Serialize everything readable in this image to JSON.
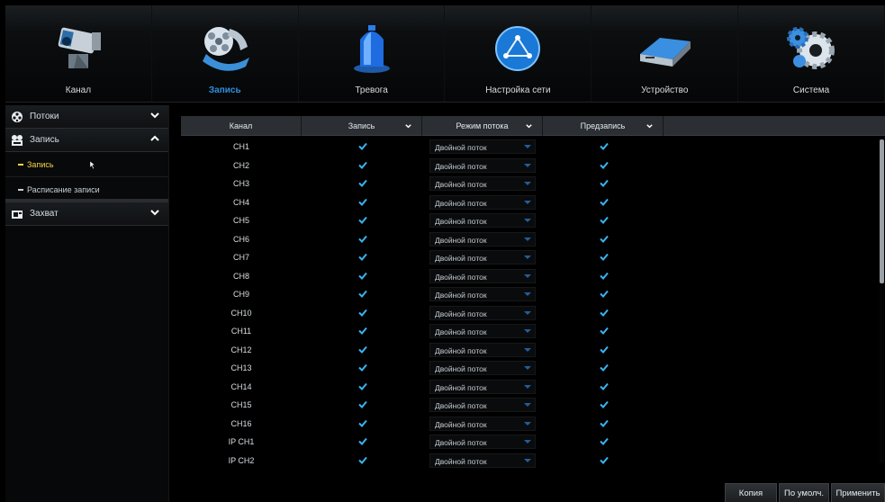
{
  "nav": {
    "tabs": [
      {
        "label": "Канал",
        "icon": "camera-icon",
        "active": false
      },
      {
        "label": "Запись",
        "icon": "film-reel-icon",
        "active": true
      },
      {
        "label": "Тревога",
        "icon": "alarm-siren-icon",
        "active": false
      },
      {
        "label": "Настройка сети",
        "icon": "network-globe-icon",
        "active": false
      },
      {
        "label": "Устройство",
        "icon": "hard-drive-icon",
        "active": false
      },
      {
        "label": "Система",
        "icon": "gears-icon",
        "active": false
      }
    ]
  },
  "sidebar": {
    "groups": [
      {
        "label": "Потоки",
        "icon": "stream-icon",
        "expanded": false
      },
      {
        "label": "Запись",
        "icon": "record-icon",
        "expanded": true,
        "items": [
          {
            "label": "Запись",
            "active": true
          },
          {
            "label": "Расписание записи",
            "active": false
          }
        ]
      },
      {
        "label": "Захват",
        "icon": "capture-icon",
        "expanded": false
      }
    ]
  },
  "table": {
    "columns": {
      "channel": "Канал",
      "record": "Запись",
      "stream_mode": "Режим потока",
      "prerecord": "Предзапись"
    },
    "rows": [
      {
        "channel": "CH1",
        "record": true,
        "stream_mode": "Двойной поток",
        "prerecord": true
      },
      {
        "channel": "CH2",
        "record": true,
        "stream_mode": "Двойной поток",
        "prerecord": true
      },
      {
        "channel": "CH3",
        "record": true,
        "stream_mode": "Двойной поток",
        "prerecord": true
      },
      {
        "channel": "CH4",
        "record": true,
        "stream_mode": "Двойной поток",
        "prerecord": true
      },
      {
        "channel": "CH5",
        "record": true,
        "stream_mode": "Двойной поток",
        "prerecord": true
      },
      {
        "channel": "CH6",
        "record": true,
        "stream_mode": "Двойной поток",
        "prerecord": true
      },
      {
        "channel": "CH7",
        "record": true,
        "stream_mode": "Двойной поток",
        "prerecord": true
      },
      {
        "channel": "CH8",
        "record": true,
        "stream_mode": "Двойной поток",
        "prerecord": true
      },
      {
        "channel": "CH9",
        "record": true,
        "stream_mode": "Двойной поток",
        "prerecord": true
      },
      {
        "channel": "CH10",
        "record": true,
        "stream_mode": "Двойной поток",
        "prerecord": true
      },
      {
        "channel": "CH11",
        "record": true,
        "stream_mode": "Двойной поток",
        "prerecord": true
      },
      {
        "channel": "CH12",
        "record": true,
        "stream_mode": "Двойной поток",
        "prerecord": true
      },
      {
        "channel": "CH13",
        "record": true,
        "stream_mode": "Двойной поток",
        "prerecord": true
      },
      {
        "channel": "CH14",
        "record": true,
        "stream_mode": "Двойной поток",
        "prerecord": true
      },
      {
        "channel": "CH15",
        "record": true,
        "stream_mode": "Двойной поток",
        "prerecord": true
      },
      {
        "channel": "CH16",
        "record": true,
        "stream_mode": "Двойной поток",
        "prerecord": true
      },
      {
        "channel": "IP CH1",
        "record": true,
        "stream_mode": "Двойной поток",
        "prerecord": true
      },
      {
        "channel": "IP CH2",
        "record": true,
        "stream_mode": "Двойной поток",
        "prerecord": true
      }
    ]
  },
  "buttons": {
    "copy": "Копия",
    "default": "По умолч.",
    "apply": "Применить"
  },
  "colors": {
    "accent": "#2f8fe0",
    "active_sub": "#f5d34a",
    "check": "#39b4f0"
  }
}
